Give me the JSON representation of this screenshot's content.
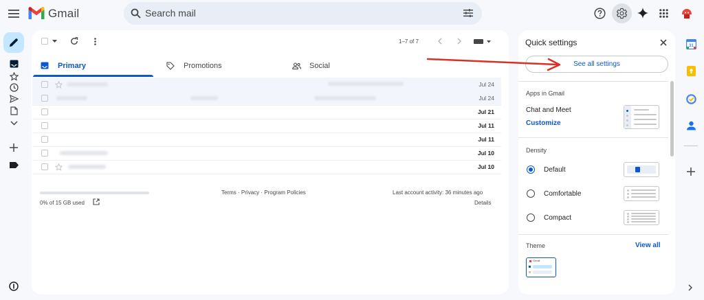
{
  "app": {
    "name": "Gmail"
  },
  "search": {
    "placeholder": "Search mail"
  },
  "toolbar": {
    "pagination": "1–7 of 7"
  },
  "tabs": [
    {
      "label": "Primary"
    },
    {
      "label": "Promotions"
    },
    {
      "label": "Social"
    }
  ],
  "emails": [
    {
      "date": "Jul 24",
      "unread": false
    },
    {
      "date": "Jul 24",
      "unread": false
    },
    {
      "date": "Jul 21",
      "unread": true
    },
    {
      "date": "Jul 11",
      "unread": true
    },
    {
      "date": "Jul 11",
      "unread": true
    },
    {
      "date": "Jul 10",
      "unread": true
    },
    {
      "date": "Jul 10",
      "unread": true
    }
  ],
  "footer": {
    "storage": "0% of 15 GB used",
    "storage_fraction": 0.0,
    "terms": "Terms",
    "privacy": "Privacy",
    "program": "Program Policies",
    "separator": "·",
    "activity": "Last account activity: 36 minutes ago",
    "details": "Details"
  },
  "quick_settings": {
    "title": "Quick settings",
    "see_all": "See all settings",
    "apps_heading": "Apps in Gmail",
    "chat_meet": "Chat and Meet",
    "customize": "Customize",
    "density_heading": "Density",
    "density_options": [
      {
        "label": "Default",
        "selected": true
      },
      {
        "label": "Comfortable",
        "selected": false
      },
      {
        "label": "Compact",
        "selected": false
      }
    ],
    "theme_heading": "Theme",
    "view_all": "View all",
    "theme_preview_label": "Gmail"
  },
  "colors": {
    "accent": "#0b57d0",
    "arrow": "#d93025",
    "gmail_red": "#ea4335",
    "gmail_blue": "#4285f4",
    "gmail_green": "#34a853",
    "gmail_yellow": "#fbbc04"
  },
  "icons": {
    "menu": "hamburger-menu-icon",
    "search": "search-icon",
    "filter": "search-options-icon",
    "help": "help-icon",
    "settings": "gear-icon",
    "gemini": "sparkle-icon",
    "apps": "apps-grid-icon",
    "compose": "pencil-icon",
    "inbox": "inbox-icon",
    "starred": "star-icon",
    "snoozed": "clock-icon",
    "sent": "send-icon",
    "drafts": "draft-icon",
    "more": "chevron-down-icon",
    "new_label": "plus-icon",
    "label": "label-icon",
    "calendar": "calendar-icon",
    "keep": "keep-icon",
    "tasks": "tasks-icon",
    "contacts": "contacts-icon"
  }
}
